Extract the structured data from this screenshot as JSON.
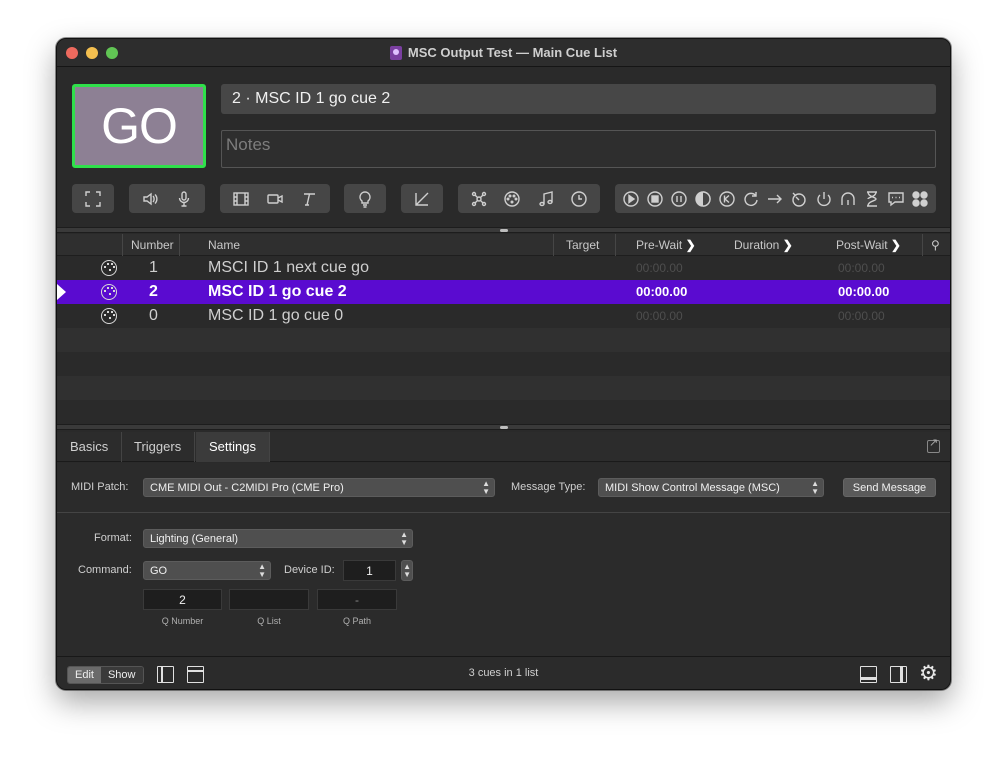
{
  "window": {
    "title": "MSC Output Test — Main Cue List"
  },
  "go_button": {
    "label": "GO"
  },
  "cue_name_field": {
    "value": "2 · MSC ID 1 go cue 2"
  },
  "notes_field": {
    "placeholder": "Notes"
  },
  "toolbar": {
    "groups": [
      [
        "fullscreen-icon"
      ],
      [
        "speaker-icon",
        "microphone-icon"
      ],
      [
        "film-icon",
        "camera-icon",
        "text-icon"
      ],
      [
        "lightbulb-icon"
      ],
      [
        "fade-icon"
      ],
      [
        "network-icon",
        "midi-icon",
        "music-note-icon",
        "clock-icon"
      ],
      [
        "play-icon",
        "stop-icon",
        "pause-icon",
        "load-icon",
        "reset-icon",
        "restart-icon",
        "goto-icon",
        "target-icon",
        "power-icon",
        "arc-icon",
        "wait-icon",
        "memo-icon",
        "group-icon"
      ]
    ]
  },
  "table": {
    "headers": {
      "number": "Number",
      "name": "Name",
      "target": "Target",
      "prewait": "Pre-Wait",
      "duration": "Duration",
      "postwait": "Post-Wait"
    },
    "rows": [
      {
        "number": "1",
        "name": "MSCI ID 1 next cue go",
        "prewait": "00:00.00",
        "postwait": "00:00.00",
        "selected": false
      },
      {
        "number": "2",
        "name": "MSC ID 1 go cue 2",
        "prewait": "00:00.00",
        "postwait": "00:00.00",
        "selected": true
      },
      {
        "number": "0",
        "name": "MSC ID 1 go cue 0",
        "prewait": "00:00.00",
        "postwait": "00:00.00",
        "selected": false
      }
    ]
  },
  "inspector": {
    "tabs": [
      "Basics",
      "Triggers",
      "Settings"
    ],
    "active_tab": "Settings",
    "midi_patch_label": "MIDI Patch:",
    "midi_patch_value": "CME MIDI Out - C2MIDI Pro (CME Pro)",
    "message_type_label": "Message Type:",
    "message_type_value": "MIDI Show Control Message (MSC)",
    "send_button": "Send Message",
    "format_label": "Format:",
    "format_value": "Lighting (General)",
    "command_label": "Command:",
    "command_value": "GO",
    "device_id_label": "Device ID:",
    "device_id_value": "1",
    "q_number_value": "2",
    "q_list_value": "",
    "q_path_value": "-",
    "q_number_label": "Q Number",
    "q_list_label": "Q List",
    "q_path_label": "Q Path"
  },
  "footer": {
    "edit_label": "Edit",
    "show_label": "Show",
    "status": "3 cues in 1 list"
  }
}
